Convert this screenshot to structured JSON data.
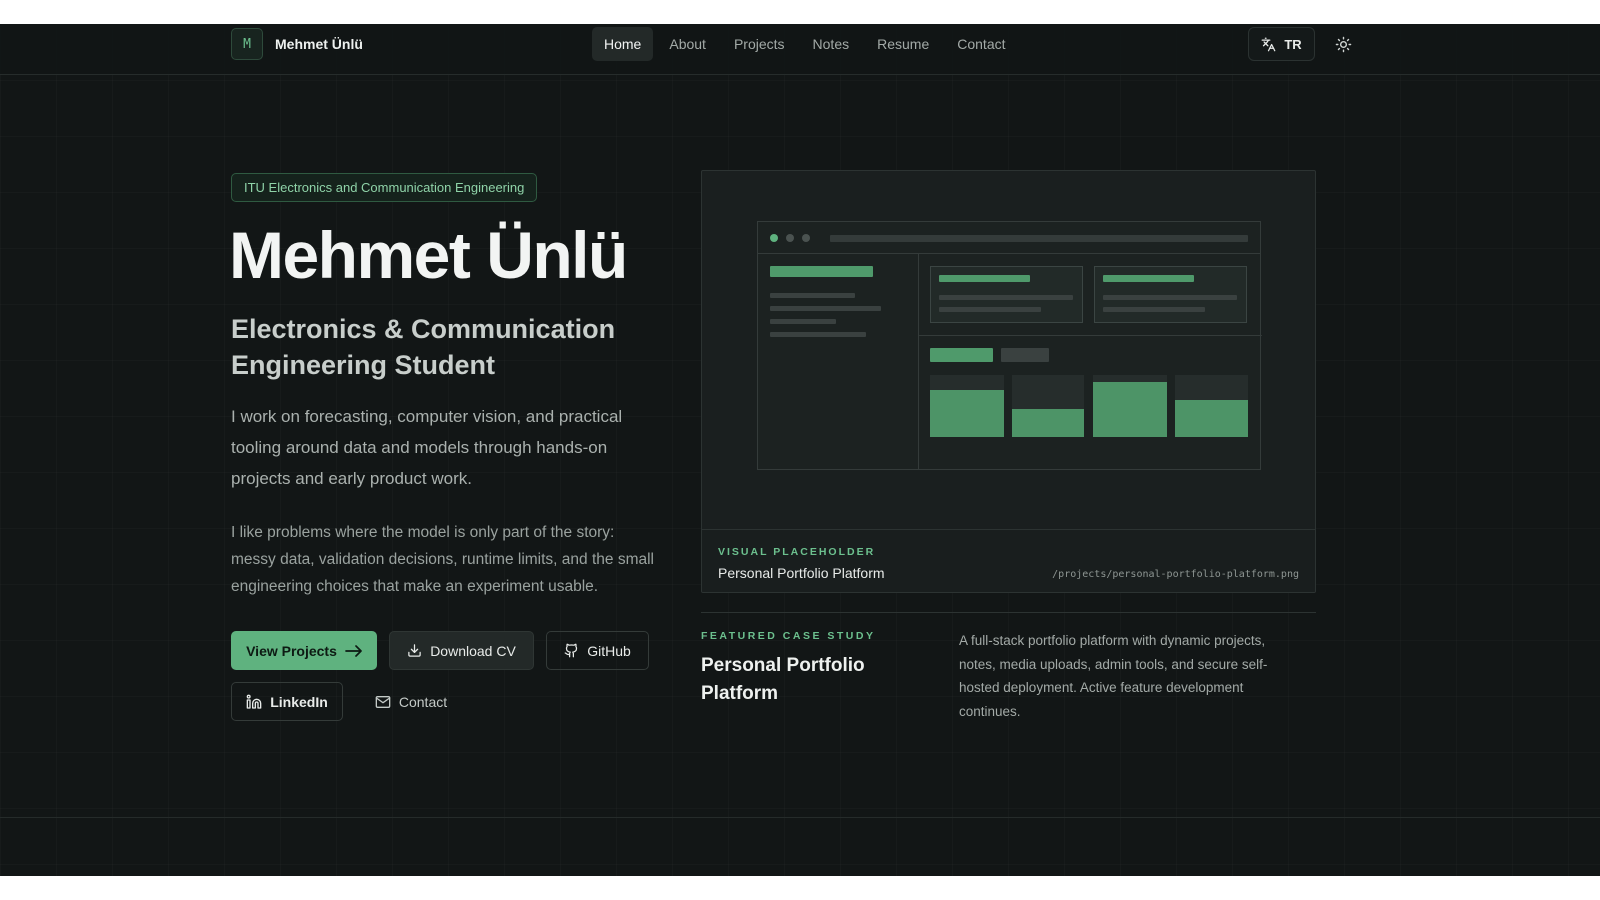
{
  "brand": {
    "mark": "M",
    "name": "Mehmet Ünlü"
  },
  "nav": {
    "items": [
      {
        "label": "Home",
        "active": true
      },
      {
        "label": "About"
      },
      {
        "label": "Projects"
      },
      {
        "label": "Notes"
      },
      {
        "label": "Resume"
      },
      {
        "label": "Contact"
      }
    ],
    "language_label": "TR",
    "icons": {
      "language": "translate-icon",
      "theme": "sun-icon"
    }
  },
  "hero": {
    "badge": "ITU Electronics and Communication Engineering",
    "title": "Mehmet Ünlü",
    "subtitle": "Electronics & Communication Engineering Student",
    "paragraph1": "I work on forecasting, computer vision, and practical tooling around data and models through hands-on projects and early product work.",
    "paragraph2": "I like problems where the model is only part of the story: messy data, validation decisions, runtime limits, and the small engineering choices that make an experiment usable.",
    "buttons": {
      "view_projects": "View Projects",
      "download_cv": "Download CV",
      "github": "GitHub",
      "linkedin": "LinkedIn",
      "contact": "Contact"
    }
  },
  "visual": {
    "label": "VISUAL PLACEHOLDER",
    "title": "Personal Portfolio Platform",
    "path": "/projects/personal-portfolio-platform.png"
  },
  "featured": {
    "label": "FEATURED CASE STUDY",
    "title": "Personal Portfolio Platform",
    "description": "A full-stack portfolio platform with dynamic projects, notes, media uploads, admin tools, and secure self-hosted deployment. Active feature development continues."
  },
  "colors": {
    "accent": "#5fb27f",
    "accent_text": "#6cc08e",
    "background": "#121616"
  }
}
